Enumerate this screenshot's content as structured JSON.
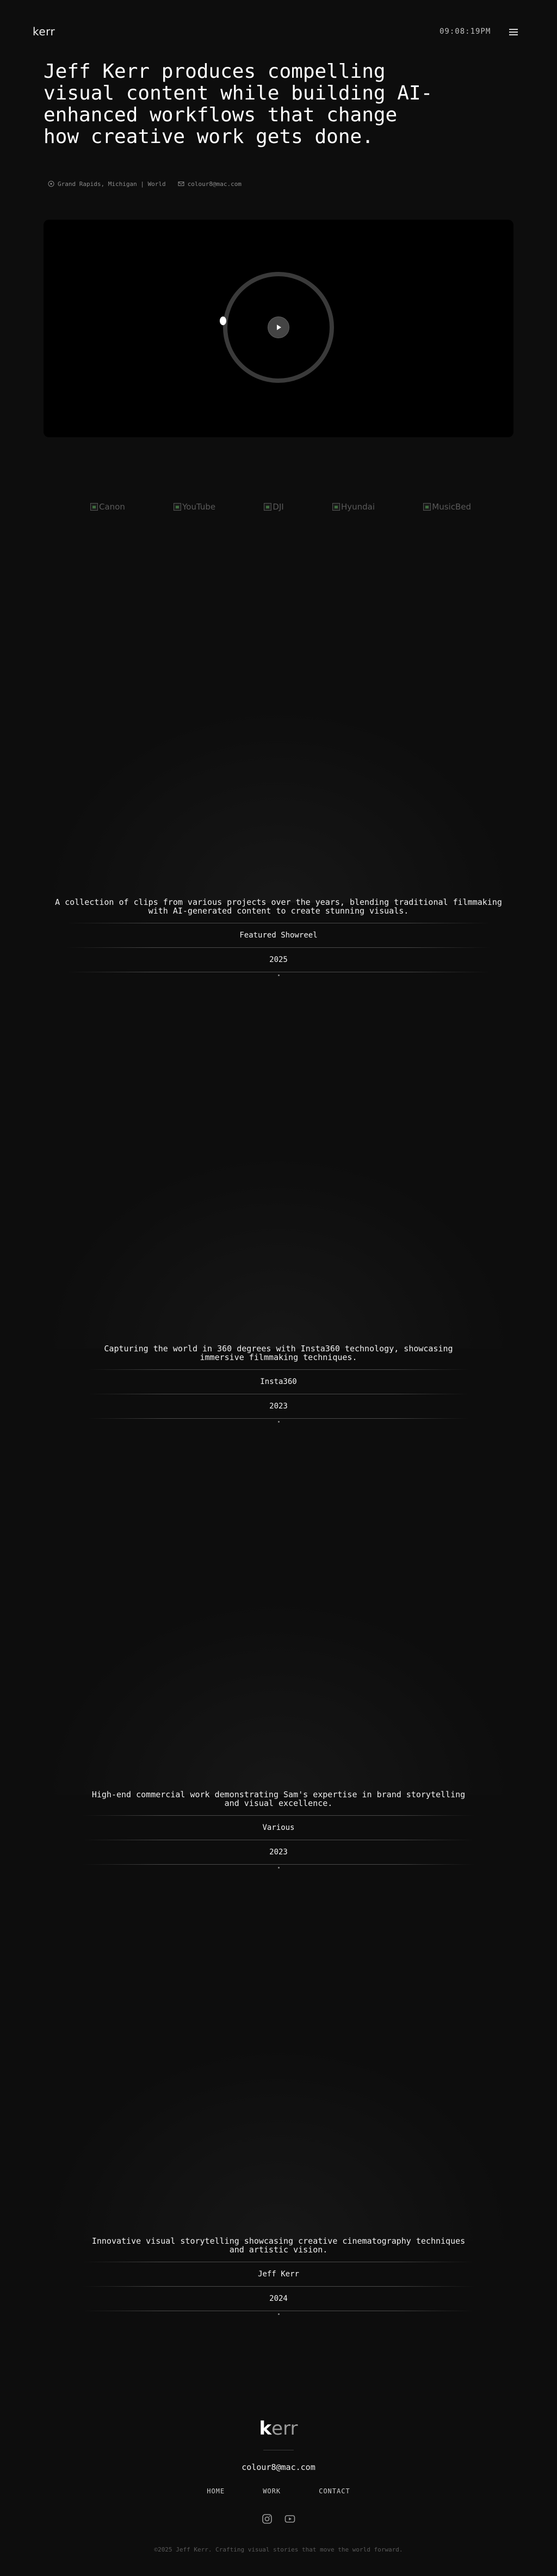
{
  "header": {
    "logo": "kerr",
    "clock": "09:08:19PM"
  },
  "hero": {
    "title": "Jeff Kerr produces compelling visual content while building AI-enhanced workflows that change how creative work gets done.",
    "location": "Grand Rapids, Michigan | World",
    "email": "colour8@mac.com"
  },
  "clients": [
    {
      "name": "Canon"
    },
    {
      "name": "YouTube"
    },
    {
      "name": "DJI"
    },
    {
      "name": "Hyundai"
    },
    {
      "name": "MusicBed"
    }
  ],
  "projects": [
    {
      "description": "A collection of clips from various projects over the years, blending traditional filmmaking with AI-generated content to create stunning visuals.",
      "client": "Featured Showreel",
      "year": "2025"
    },
    {
      "description": "Capturing the world in 360 degrees with Insta360 technology, showcasing immersive filmmaking techniques.",
      "client": "Insta360",
      "year": "2023"
    },
    {
      "description": "High-end commercial work demonstrating Sam's expertise in brand storytelling and visual excellence.",
      "client": "Various",
      "year": "2023"
    },
    {
      "description": "Innovative visual storytelling showcasing creative cinematography techniques and artistic vision.",
      "client": "Jeff Kerr",
      "year": "2024"
    }
  ],
  "footer": {
    "logo_k": "k",
    "logo_rest": "err",
    "email": "colour8@mac.com",
    "nav": [
      "HOME",
      "WORK",
      "CONTACT"
    ],
    "copyright": "©2025 Jeff Kerr. Crafting visual stories that move the world forward."
  },
  "icons": {
    "menu": "hamburger-icon",
    "location": "pin-icon",
    "email": "mail-icon",
    "play": "play-icon",
    "social": [
      "instagram-icon",
      "youtube-icon"
    ]
  }
}
